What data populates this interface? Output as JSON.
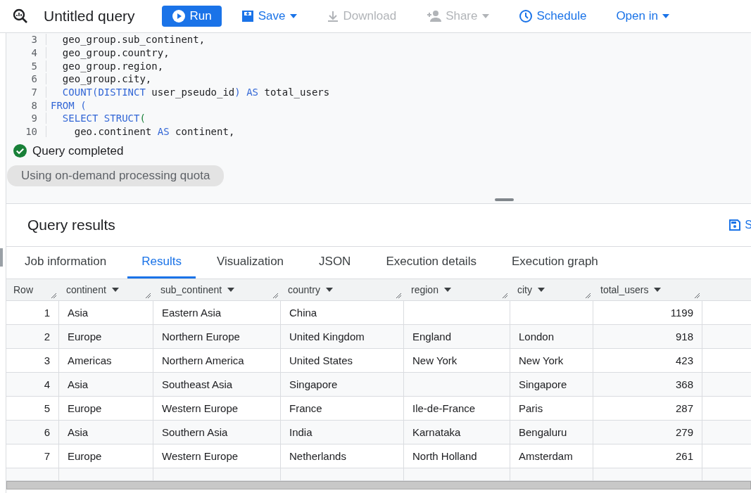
{
  "toolbar": {
    "title": "Untitled query",
    "buttons": [
      {
        "kind": "primary",
        "label": "Run",
        "disabled": false,
        "caret": false
      },
      {
        "kind": "text",
        "label": "Save",
        "disabled": false,
        "caret": true
      },
      {
        "kind": "text",
        "label": "Download",
        "disabled": true,
        "caret": false
      },
      {
        "kind": "text",
        "label": "Share",
        "disabled": true,
        "caret": true
      },
      {
        "kind": "text",
        "label": "Schedule",
        "disabled": false,
        "caret": false
      },
      {
        "kind": "text",
        "label": "Open in",
        "disabled": false,
        "caret": true
      }
    ]
  },
  "editor": {
    "lines": [
      {
        "number": "3",
        "tokens": [
          {
            "kind": "plain",
            "text": "  geo_group.sub_continent,"
          }
        ]
      },
      {
        "number": "4",
        "tokens": [
          {
            "kind": "plain",
            "text": "  geo_group.country,"
          }
        ]
      },
      {
        "number": "5",
        "tokens": [
          {
            "kind": "plain",
            "text": "  geo_group.region,"
          }
        ]
      },
      {
        "number": "6",
        "tokens": [
          {
            "kind": "plain",
            "text": "  geo_group.city,"
          }
        ]
      },
      {
        "number": "7",
        "tokens": [
          {
            "kind": "keyword",
            "text": "  COUNT(DISTINCT"
          },
          {
            "kind": "plain",
            "text": " user_pseudo_id"
          },
          {
            "kind": "keyword",
            "text": ")"
          },
          {
            "kind": "keyword",
            "text": " AS"
          },
          {
            "kind": "plain",
            "text": " total_users"
          }
        ]
      },
      {
        "number": "8",
        "tokens": [
          {
            "kind": "keyword",
            "text": "FROM ("
          }
        ]
      },
      {
        "number": "9",
        "tokens": [
          {
            "kind": "keyword",
            "text": "  SELECT STRUCT"
          },
          {
            "kind": "bracket",
            "text": "("
          }
        ]
      },
      {
        "number": "10",
        "tokens": [
          {
            "kind": "plain",
            "text": "    geo.continent"
          },
          {
            "kind": "keyword",
            "text": " AS"
          },
          {
            "kind": "plain",
            "text": " continent,"
          }
        ]
      }
    ]
  },
  "status": {
    "message": "Query completed",
    "quota": "Using on-demand processing quota"
  },
  "results": {
    "title": "Query results",
    "save_label": "S",
    "tabs": [
      {
        "label": "Job information",
        "selected": false
      },
      {
        "label": "Results",
        "selected": true
      },
      {
        "label": "Visualization",
        "selected": false
      },
      {
        "label": "JSON",
        "selected": false
      },
      {
        "label": "Execution details",
        "selected": false
      },
      {
        "label": "Execution graph",
        "selected": false
      }
    ],
    "columns": [
      {
        "label": "Row",
        "sortable": false
      },
      {
        "label": "continent",
        "sortable": true
      },
      {
        "label": "sub_continent",
        "sortable": true
      },
      {
        "label": "country",
        "sortable": true
      },
      {
        "label": "region",
        "sortable": true
      },
      {
        "label": "city",
        "sortable": true
      },
      {
        "label": "total_users",
        "sortable": true
      }
    ],
    "rows": [
      [
        "1",
        "Asia",
        "Eastern Asia",
        "China",
        "",
        "",
        "1199"
      ],
      [
        "2",
        "Europe",
        "Northern Europe",
        "United Kingdom",
        "England",
        "London",
        "918"
      ],
      [
        "3",
        "Americas",
        "Northern America",
        "United States",
        "New York",
        "New York",
        "423"
      ],
      [
        "4",
        "Asia",
        "Southeast Asia",
        "Singapore",
        "",
        "Singapore",
        "368"
      ],
      [
        "5",
        "Europe",
        "Western Europe",
        "France",
        "Ile-de-France",
        "Paris",
        "287"
      ],
      [
        "6",
        "Asia",
        "Southern Asia",
        "India",
        "Karnataka",
        "Bengaluru",
        "279"
      ],
      [
        "7",
        "Europe",
        "Western Europe",
        "Netherlands",
        "North Holland",
        "Amsterdam",
        "261"
      ]
    ]
  }
}
